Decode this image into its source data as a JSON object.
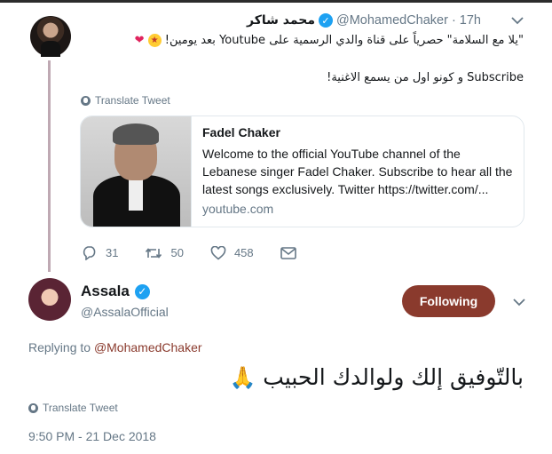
{
  "parent_tweet": {
    "name": "محمد شاكر",
    "handle": "@MohamedChaker",
    "time": "17h",
    "text_line1": "\"يلا مع السلامة\" حصرياً على قناة والدي الرسمية على Youtube بعد يومين!",
    "text_line2": "Subscribe و كونو اول من يسمع الاغنية!",
    "translate_label": "Translate Tweet",
    "card": {
      "title": "Fadel Chaker",
      "description": "Welcome to the official YouTube channel of the Lebanese singer Fadel Chaker. Subscribe to hear all the latest songs exclusively. Twitter https://twitter.com/...",
      "domain": "youtube.com"
    },
    "actions": {
      "replies": "31",
      "retweets": "50",
      "likes": "458"
    }
  },
  "main_tweet": {
    "name": "Assala",
    "handle": "@AssalaOfficial",
    "follow_label": "Following",
    "replying_prefix": "Replying to",
    "replying_to": "@MohamedChaker",
    "text": "بالتّوفيق إلك ولوالدك الحبيب",
    "translate_label": "Translate Tweet",
    "timestamp": "9:50 PM - 21 Dec 2018"
  },
  "colors": {
    "accent": "#8a3a2d",
    "verified": "#1da1f2",
    "muted": "#657786"
  },
  "icons": [
    "chevron-down-icon",
    "verified-icon",
    "globe-icon",
    "reply-icon",
    "retweet-icon",
    "like-icon",
    "message-icon"
  ]
}
